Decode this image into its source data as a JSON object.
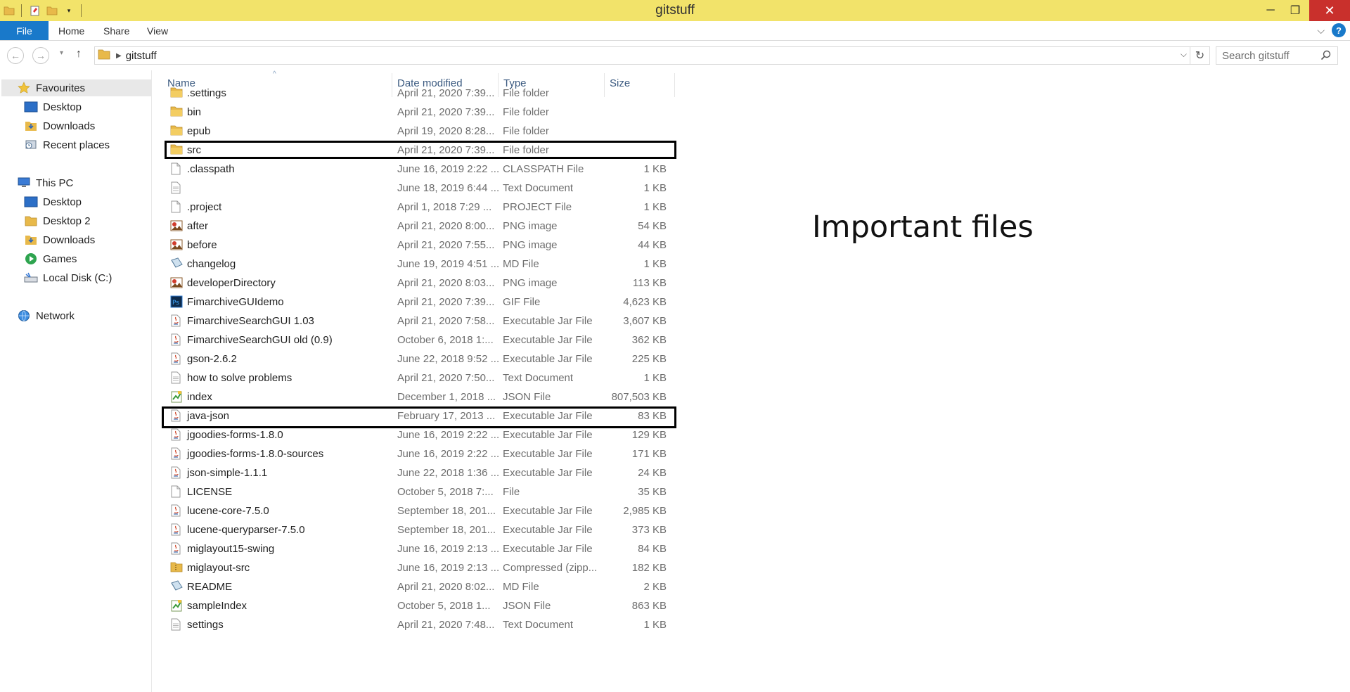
{
  "window": {
    "title": "gitstuff",
    "minimize": "─",
    "maximize": "❐",
    "close": "✕"
  },
  "ribbon": {
    "file": "File",
    "tabs": [
      "Home",
      "Share",
      "View"
    ],
    "help": "?"
  },
  "address": {
    "path": [
      "gitstuff"
    ],
    "search_placeholder": "Search gitstuff"
  },
  "nav": {
    "groups": [
      {
        "label": "Favourites",
        "icon": "star-icon",
        "items": [
          {
            "label": "Desktop",
            "icon": "desktop-icon"
          },
          {
            "label": "Downloads",
            "icon": "downloads-icon"
          },
          {
            "label": "Recent places",
            "icon": "recent-places-icon"
          }
        ]
      },
      {
        "label": "This PC",
        "icon": "computer-icon",
        "items": [
          {
            "label": "Desktop",
            "icon": "desktop-icon"
          },
          {
            "label": "Desktop 2",
            "icon": "folder-icon"
          },
          {
            "label": "Downloads",
            "icon": "downloads-icon"
          },
          {
            "label": "Games",
            "icon": "games-icon"
          },
          {
            "label": "Local Disk (C:)",
            "icon": "drive-icon"
          }
        ]
      },
      {
        "label": "Network",
        "icon": "network-icon",
        "items": []
      }
    ]
  },
  "columns": {
    "name": "Name",
    "date": "Date modified",
    "type": "Type",
    "size": "Size"
  },
  "files": [
    {
      "name": ".settings",
      "date": "April 21, 2020 7:39...",
      "type": "File folder",
      "size": "",
      "icon": "folder-icon"
    },
    {
      "name": "bin",
      "date": "April 21, 2020 7:39...",
      "type": "File folder",
      "size": "",
      "icon": "folder-icon"
    },
    {
      "name": "epub",
      "date": "April 19, 2020 8:28...",
      "type": "File folder",
      "size": "",
      "icon": "folder-icon"
    },
    {
      "name": "src",
      "date": "April 21, 2020 7:39...",
      "type": "File folder",
      "size": "",
      "icon": "folder-icon"
    },
    {
      "name": ".classpath",
      "date": "June 16, 2019 2:22 ...",
      "type": "CLASSPATH File",
      "size": "1 KB",
      "icon": "blank-file-icon"
    },
    {
      "name": "",
      "date": "June 18, 2019 6:44 ...",
      "type": "Text Document",
      "size": "1 KB",
      "icon": "text-file-icon"
    },
    {
      "name": ".project",
      "date": "April 1, 2018 7:29 ...",
      "type": "PROJECT File",
      "size": "1 KB",
      "icon": "blank-file-icon"
    },
    {
      "name": "after",
      "date": "April 21, 2020 8:00...",
      "type": "PNG image",
      "size": "54 KB",
      "icon": "image-file-icon"
    },
    {
      "name": "before",
      "date": "April 21, 2020 7:55...",
      "type": "PNG image",
      "size": "44 KB",
      "icon": "image-file-icon"
    },
    {
      "name": "changelog",
      "date": "June 19, 2019 4:51 ...",
      "type": "MD File",
      "size": "1 KB",
      "icon": "md-file-icon"
    },
    {
      "name": "developerDirectory",
      "date": "April 21, 2020 8:03...",
      "type": "PNG image",
      "size": "113 KB",
      "icon": "image-file-icon"
    },
    {
      "name": "FimarchiveGUIdemo",
      "date": "April 21, 2020 7:39...",
      "type": "GIF File",
      "size": "4,623 KB",
      "icon": "photoshop-file-icon"
    },
    {
      "name": "FimarchiveSearchGUI 1.03",
      "date": "April 21, 2020 7:58...",
      "type": "Executable Jar File",
      "size": "3,607 KB",
      "icon": "java-jar-icon"
    },
    {
      "name": "FimarchiveSearchGUI old (0.9)",
      "date": "October 6, 2018 1:...",
      "type": "Executable Jar File",
      "size": "362 KB",
      "icon": "java-jar-icon"
    },
    {
      "name": "gson-2.6.2",
      "date": "June 22, 2018 9:52 ...",
      "type": "Executable Jar File",
      "size": "225 KB",
      "icon": "java-jar-icon"
    },
    {
      "name": "how to solve problems",
      "date": "April 21, 2020 7:50...",
      "type": "Text Document",
      "size": "1 KB",
      "icon": "text-file-icon"
    },
    {
      "name": "index",
      "date": "December 1, 2018 ...",
      "type": "JSON File",
      "size": "807,503 KB",
      "icon": "json-file-icon"
    },
    {
      "name": "java-json",
      "date": "February 17, 2013 ...",
      "type": "Executable Jar File",
      "size": "83 KB",
      "icon": "java-jar-icon"
    },
    {
      "name": "jgoodies-forms-1.8.0",
      "date": "June 16, 2019 2:22 ...",
      "type": "Executable Jar File",
      "size": "129 KB",
      "icon": "java-jar-icon"
    },
    {
      "name": "jgoodies-forms-1.8.0-sources",
      "date": "June 16, 2019 2:22 ...",
      "type": "Executable Jar File",
      "size": "171 KB",
      "icon": "java-jar-icon"
    },
    {
      "name": "json-simple-1.1.1",
      "date": "June 22, 2018 1:36 ...",
      "type": "Executable Jar File",
      "size": "24 KB",
      "icon": "java-jar-icon"
    },
    {
      "name": "LICENSE",
      "date": "October 5, 2018 7:...",
      "type": "File",
      "size": "35 KB",
      "icon": "blank-file-icon"
    },
    {
      "name": "lucene-core-7.5.0",
      "date": "September 18, 201...",
      "type": "Executable Jar File",
      "size": "2,985 KB",
      "icon": "java-jar-icon"
    },
    {
      "name": "lucene-queryparser-7.5.0",
      "date": "September 18, 201...",
      "type": "Executable Jar File",
      "size": "373 KB",
      "icon": "java-jar-icon"
    },
    {
      "name": "miglayout15-swing",
      "date": "June 16, 2019 2:13 ...",
      "type": "Executable Jar File",
      "size": "84 KB",
      "icon": "java-jar-icon"
    },
    {
      "name": "miglayout-src",
      "date": "June 16, 2019 2:13 ...",
      "type": "Compressed (zipp...",
      "size": "182 KB",
      "icon": "zip-file-icon"
    },
    {
      "name": "README",
      "date": "April 21, 2020 8:02...",
      "type": "MD File",
      "size": "2 KB",
      "icon": "md-file-icon"
    },
    {
      "name": "sampleIndex",
      "date": "October 5, 2018 1...",
      "type": "JSON File",
      "size": "863 KB",
      "icon": "json-file-icon"
    },
    {
      "name": "settings",
      "date": "April 21, 2020 7:48...",
      "type": "Text Document",
      "size": "1 KB",
      "icon": "text-file-icon"
    }
  ],
  "highlighted_rows": [
    2,
    16
  ],
  "annotation": {
    "text": "Important files"
  },
  "colors": {
    "titlebar": "#f2e36a",
    "file_tab": "#1979ca",
    "close_button": "#c9302c",
    "folder": "#e8b94a",
    "header_text": "#3b5a80"
  }
}
